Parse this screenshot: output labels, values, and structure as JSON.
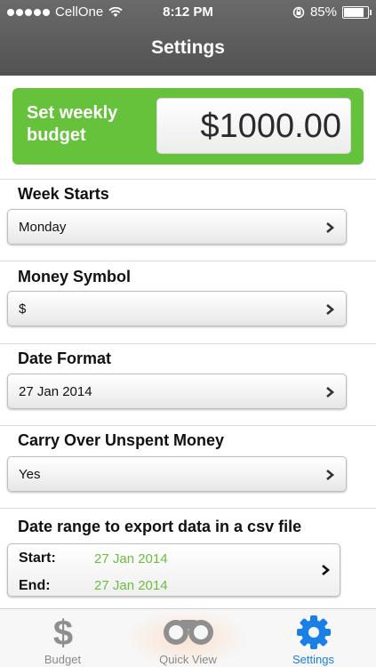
{
  "status_bar": {
    "carrier": "CellOne",
    "time": "8:12 PM",
    "battery_percent": "85%",
    "battery_level": 0.85
  },
  "nav": {
    "title": "Settings"
  },
  "budget": {
    "label": "Set weekly budget",
    "value": "$1000.00",
    "accent_color": "#65c23a"
  },
  "settings": {
    "week_starts": {
      "title": "Week Starts",
      "value": "Monday"
    },
    "money_symbol": {
      "title": "Money Symbol",
      "value": "$"
    },
    "date_format": {
      "title": "Date Format",
      "value": "27 Jan 2014"
    },
    "carry_over": {
      "title": "Carry Over Unspent Money",
      "value": "Yes"
    }
  },
  "export": {
    "title": "Date range to export data in a csv file",
    "start_label": "Start:",
    "start_value": "27 Jan 2014",
    "end_label": "End:",
    "end_value": "27 Jan 2014"
  },
  "tabs": [
    {
      "label": "Budget",
      "icon": "dollar-icon",
      "active": false
    },
    {
      "label": "Quick View",
      "icon": "binoculars-icon",
      "active": false
    },
    {
      "label": "Settings",
      "icon": "gear-icon",
      "active": true
    }
  ]
}
